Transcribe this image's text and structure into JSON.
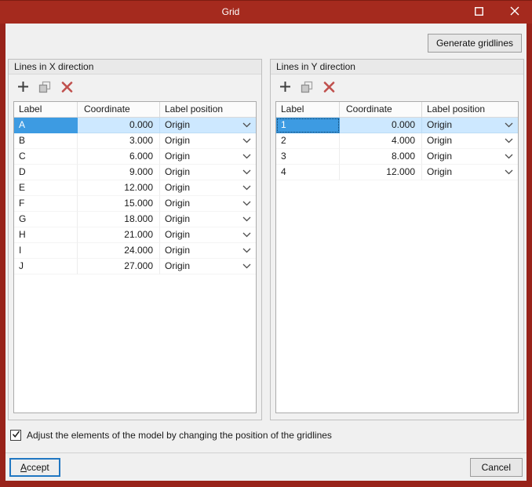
{
  "window": {
    "title": "Grid"
  },
  "colors": {
    "titlebar": "#a52a1e",
    "window_border": "#98231a",
    "selection_blue": "#3d9be2",
    "selection_light": "#cde8ff",
    "delete_red": "#c0504d"
  },
  "titlebar_icons": [
    "maximize-icon",
    "close-icon"
  ],
  "topbar": {
    "generate_button": "Generate gridlines"
  },
  "panels": [
    {
      "title": "Lines in X direction",
      "toolbar_icons": [
        "add-icon",
        "duplicate-icon",
        "delete-icon"
      ],
      "columns": [
        "Label",
        "Coordinate",
        "Label position"
      ],
      "rows": [
        [
          "A",
          "0.000",
          "Origin"
        ],
        [
          "B",
          "3.000",
          "Origin"
        ],
        [
          "C",
          "6.000",
          "Origin"
        ],
        [
          "D",
          "9.000",
          "Origin"
        ],
        [
          "E",
          "12.000",
          "Origin"
        ],
        [
          "F",
          "15.000",
          "Origin"
        ],
        [
          "G",
          "18.000",
          "Origin"
        ],
        [
          "H",
          "21.000",
          "Origin"
        ],
        [
          "I",
          "24.000",
          "Origin"
        ],
        [
          "J",
          "27.000",
          "Origin"
        ]
      ],
      "selected_row": 0,
      "focused": false
    },
    {
      "title": "Lines in Y direction",
      "toolbar_icons": [
        "add-icon",
        "duplicate-icon",
        "delete-icon"
      ],
      "columns": [
        "Label",
        "Coordinate",
        "Label position"
      ],
      "rows": [
        [
          "1",
          "0.000",
          "Origin"
        ],
        [
          "2",
          "4.000",
          "Origin"
        ],
        [
          "3",
          "8.000",
          "Origin"
        ],
        [
          "4",
          "12.000",
          "Origin"
        ]
      ],
      "selected_row": 0,
      "focused": true
    }
  ],
  "footer": {
    "checkbox_checked": true,
    "checkbox_label": "Adjust the elements of the model by changing the position of the gridlines",
    "accept_button": "Accept",
    "cancel_button": "Cancel"
  }
}
